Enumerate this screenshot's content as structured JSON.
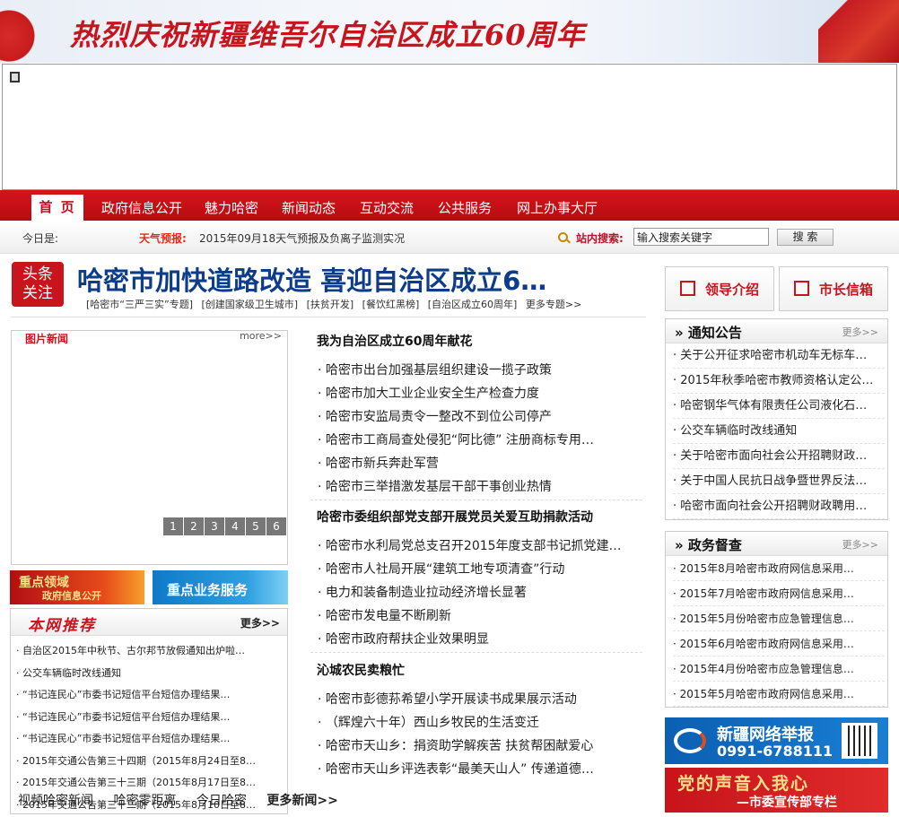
{
  "banner": {
    "text": "热烈庆祝新疆维吾尔自治区成立60周年"
  },
  "nav": {
    "items": [
      {
        "label": "首 页",
        "active": true
      },
      {
        "label": "政府信息公开"
      },
      {
        "label": "魅力哈密"
      },
      {
        "label": "新闻动态"
      },
      {
        "label": "互动交流"
      },
      {
        "label": "公共服务"
      },
      {
        "label": "网上办事大厅"
      }
    ]
  },
  "infobar": {
    "today_label": "今日是:",
    "weather_label": "天气预报:",
    "weather_text": "2015年09月18天气预报及负离子监测实况",
    "search_label": "站内搜索:",
    "search_value": "输入搜索关键字",
    "search_button": "搜 索"
  },
  "headline": {
    "badge_line1": "头条",
    "badge_line2": "关注",
    "title": "哈密市加快道路改造 喜迎自治区成立6…",
    "topics": [
      "[哈密市“三严三实”专题]",
      "[创建国家级卫生城市]",
      "[扶贫开发]",
      "[餐饮红黑榜]",
      "[自治区成立60周年]"
    ],
    "topics_more": "更多专题>>"
  },
  "photo_news": {
    "title": "图片新闻",
    "more": "more>>",
    "pages": [
      "1",
      "2",
      "3",
      "4",
      "5",
      "6"
    ]
  },
  "promos": {
    "promo1_line1": "重点领域",
    "promo1_line2": "政府信息公开",
    "promo2": "重点业务服务"
  },
  "recommend": {
    "title": "本网推荐",
    "more": "更多>>",
    "items": [
      "自治区2015年中秋节、古尔邦节放假通知出炉啦…",
      "公交车辆临时改线通知",
      "“书记连民心”市委书记短信平台短信办理结果…",
      "“书记连民心”市委书记短信平台短信办理结果…",
      "“书记连民心”市委书记短信平台短信办理结果…",
      "2015年交通公告第三十四期（2015年8月24日至8…",
      "2015年交通公告第三十三期（2015年8月17日至8…",
      "2015年交通公告第三十二期（2015年8月10日至8…"
    ]
  },
  "mid_news": [
    {
      "head": "我为自治区成立60周年献花",
      "items": [
        "哈密市出台加强基层组织建设一揽子政策",
        "哈密市加大工业企业安全生产检查力度",
        "哈密市安监局责令一整改不到位公司停产",
        "哈密市工商局查处侵犯“阿比德” 注册商标专用…",
        "哈密市新兵奔赴军营",
        "哈密市三举措激发基层干部干事创业热情"
      ]
    },
    {
      "head": "哈密市委组织部党支部开展党员关爱互助捐款活动",
      "items": [
        "哈密市水利局党总支召开2015年度支部书记抓党建…",
        "哈密市人社局开展“建筑工地专项清查”行动",
        "电力和装备制造业拉动经济增长显著",
        "哈密市发电量不断刷新",
        "哈密市政府帮扶企业效果明显"
      ]
    },
    {
      "head": "沁城农民卖粮忙",
      "items": [
        "哈密市彭德荪希望小学开展读书成果展示活动",
        "（辉煌六十年）西山乡牧民的生活变迁",
        "哈密市天山乡：捐资助学解疾苦 扶贫帮困献爱心",
        "哈密市天山乡评选表彰“最美天山人” 传递道德…"
      ]
    }
  ],
  "mid_bottom": {
    "links": [
      "视频哈密新闻",
      "哈密零距离",
      "今日哈密"
    ],
    "more": "更多新闻>>"
  },
  "right_buttons": {
    "leaders": "领导介绍",
    "mayor_mail": "市长信箱"
  },
  "notices": {
    "title": "通知公告",
    "more": "更多>>",
    "items": [
      "关于公开征求哈密市机动车无标车…",
      "2015年秋季哈密市教师资格认定公…",
      "哈密钢华气体有限责任公司液化石…",
      "公交车辆临时改线通知",
      "关于哈密市面向社会公开招聘财政…",
      "关于中国人民抗日战争暨世界反法…",
      "哈密市面向社会公开招聘财政聘用…"
    ]
  },
  "supervision": {
    "title": "政务督查",
    "more": "更多>>",
    "items": [
      "2015年8月哈密市政府网信息采用…",
      "2015年7月哈密市政府网信息采用…",
      "2015年5月份哈密市应急管理信息…",
      "2015年6月哈密市政府网信息采用…",
      "2015年4月份哈密市应急管理信息…",
      "2015年5月哈密市政府网信息采用…"
    ]
  },
  "right_banners": {
    "report_title": "新疆网络举报",
    "report_phone": "0991-6788111",
    "party_line1": "党的声音入我心",
    "party_line2": "—市委宣传部专栏"
  },
  "colors": {
    "brand_red": "#c8141c",
    "headline_blue": "#0d3c8a"
  }
}
